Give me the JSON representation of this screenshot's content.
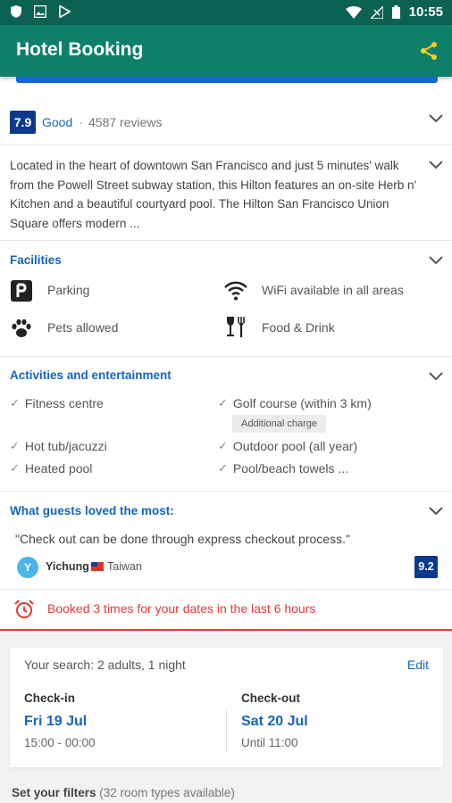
{
  "status_bar": {
    "time": "10:55"
  },
  "app_bar": {
    "title": "Hotel Booking"
  },
  "rating": {
    "score": "7.9",
    "word": "Good",
    "separator": "·",
    "reviews": "4587 reviews"
  },
  "description": "Located in the heart of downtown San Francisco and just 5 minutes' walk from the Powell Street subway station, this Hilton features an on-site Herb n' Kitchen and a beautiful courtyard pool. The Hilton San Francisco Union Square offers modern ...",
  "facilities": {
    "title": "Facilities",
    "items": [
      {
        "label": "Parking",
        "icon": "parking-icon"
      },
      {
        "label": "WiFi available in all areas",
        "icon": "wifi-icon"
      },
      {
        "label": "Pets allowed",
        "icon": "paw-icon"
      },
      {
        "label": "Food & Drink",
        "icon": "food-drink-icon"
      }
    ]
  },
  "activities": {
    "title": "Activities and entertainment",
    "items": [
      "Fitness centre",
      "Golf course (within 3 km)",
      "Hot tub/jacuzzi",
      "Outdoor pool (all year)",
      "Heated pool",
      "Pool/beach towels ..."
    ],
    "charge_label": "Additional charge"
  },
  "loved": {
    "title": "What guests loved the most:",
    "quote": "\"Check out can be done through express checkout process.\"",
    "guest_initial": "Y",
    "guest_name": "Yichung",
    "guest_country": "Taiwan",
    "guest_score": "9.2"
  },
  "alert": {
    "text": "Booked 3 times for your dates in the last 6 hours"
  },
  "search": {
    "summary": "Your search: 2 adults, 1 night",
    "edit_label": "Edit",
    "checkin_label": "Check-in",
    "checkin_date": "Fri 19 Jul",
    "checkin_time": "15:00 - 00:00",
    "checkout_label": "Check-out",
    "checkout_date": "Sat 20 Jul",
    "checkout_time": "Until 11:00"
  },
  "filters": {
    "label": "Set your filters",
    "count": "(32 room types available)"
  },
  "colors": {
    "status_bar": "#0b6152",
    "app_bar": "#0e7f6b",
    "accent_blue": "#1565c0",
    "rating_badge": "#0b3a8c",
    "alert_red": "#e53935",
    "share_icon": "#f5d313"
  }
}
